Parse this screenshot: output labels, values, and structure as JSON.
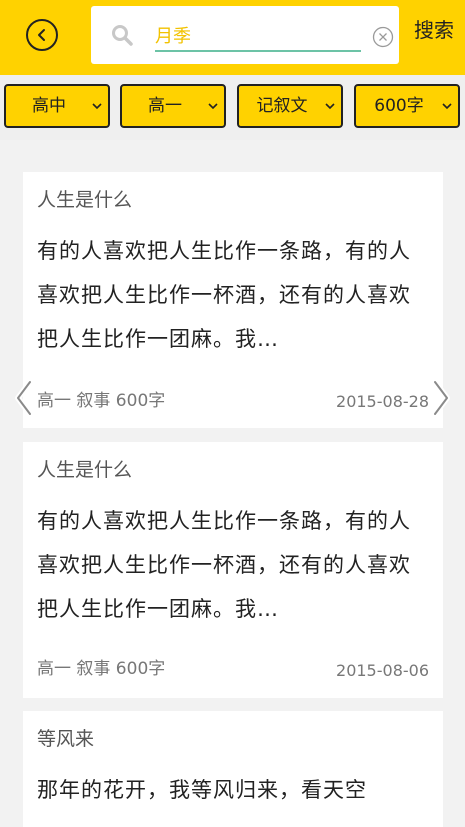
{
  "header": {
    "search_value": "月季",
    "search_label": "搜索"
  },
  "filters": [
    {
      "label": "高中"
    },
    {
      "label": "高一"
    },
    {
      "label": "记叙文"
    },
    {
      "label": "600字"
    }
  ],
  "articles": [
    {
      "title": "人生是什么",
      "excerpt": "有的人喜欢把人生比作一条路，有的人喜欢把人生比作一杯酒，还有的人喜欢把人生比作一团麻。我…",
      "meta": "高一 叙事 600字",
      "date": "2015-08-28"
    },
    {
      "title": "人生是什么",
      "excerpt": "有的人喜欢把人生比作一条路，有的人喜欢把人生比作一杯酒，还有的人喜欢把人生比作一团麻。我…",
      "meta": "高一 叙事 600字",
      "date": "2015-08-06"
    },
    {
      "title": "等风来",
      "excerpt": "那年的花开，我等风归来，看天空"
    }
  ],
  "colors": {
    "header_bg": "#ffd200",
    "filter_bg": "#ffd200",
    "input_text": "#f2c200",
    "input_underline": "#6cc3a6",
    "page_bg": "#f2f2f2",
    "card_bg": "#ffffff"
  },
  "icons": {
    "back": "back-circle-icon",
    "search": "search-icon",
    "clear": "clear-circle-icon",
    "dropdown": "chevron-down-icon",
    "prev": "chevron-left-icon",
    "next": "chevron-right-icon"
  }
}
